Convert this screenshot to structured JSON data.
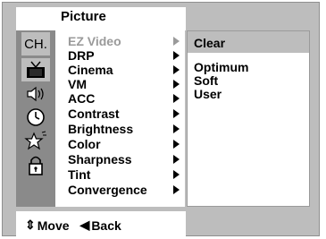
{
  "menu": {
    "title": "Picture",
    "items": [
      {
        "label": "EZ Video",
        "dimmed": true
      },
      {
        "label": "DRP",
        "dimmed": false
      },
      {
        "label": "Cinema",
        "dimmed": false
      },
      {
        "label": "VM",
        "dimmed": false
      },
      {
        "label": "ACC",
        "dimmed": false
      },
      {
        "label": "Contrast",
        "dimmed": false
      },
      {
        "label": "Brightness",
        "dimmed": false
      },
      {
        "label": "Color",
        "dimmed": false
      },
      {
        "label": "Sharpness",
        "dimmed": false
      },
      {
        "label": "Tint",
        "dimmed": false
      },
      {
        "label": "Convergence",
        "dimmed": false
      }
    ]
  },
  "side_icons": {
    "ch_label": "CH.",
    "icons": [
      "tv-icon",
      "speaker-icon",
      "clock-icon",
      "star-icon",
      "lock-icon"
    ]
  },
  "submenu": {
    "selected": "Clear",
    "items": [
      "Clear",
      "Optimum",
      "Soft",
      "User"
    ]
  },
  "footer": {
    "move_label": "Move",
    "back_label": "Back",
    "move_glyph": "⇕",
    "back_glyph": "◀"
  }
}
